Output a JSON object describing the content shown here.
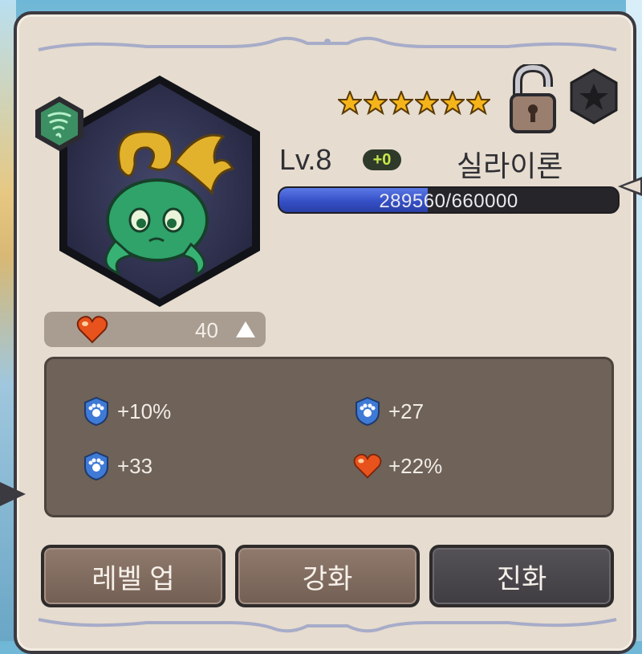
{
  "character": {
    "level_label": "Lv.8",
    "enhance_badge": "+0",
    "name": "실라이론",
    "star_count": 6,
    "element_icon": "wind-element-icon"
  },
  "exp": {
    "text": "289560/660000",
    "fill_fraction": 0.4387
  },
  "power": {
    "value": "40",
    "icon": "heart-icon",
    "trend_icon": "up-arrow-icon"
  },
  "stats": [
    {
      "icon": "shield-paw-icon",
      "value": "+10%"
    },
    {
      "icon": "shield-paw-icon",
      "value": "+27"
    },
    {
      "icon": "shield-paw-icon",
      "value": "+33"
    },
    {
      "icon": "heart-icon",
      "value": "+22%"
    }
  ],
  "buttons": {
    "level_up": "레벨 업",
    "enhance": "강화",
    "evolve": "진화"
  },
  "colors": {
    "panel_bg": "#e6dccf",
    "exp_fill": "#3550c6",
    "stats_bg": "#6e6259",
    "star": "#f5b51a",
    "badge_text": "#c8e84a"
  }
}
